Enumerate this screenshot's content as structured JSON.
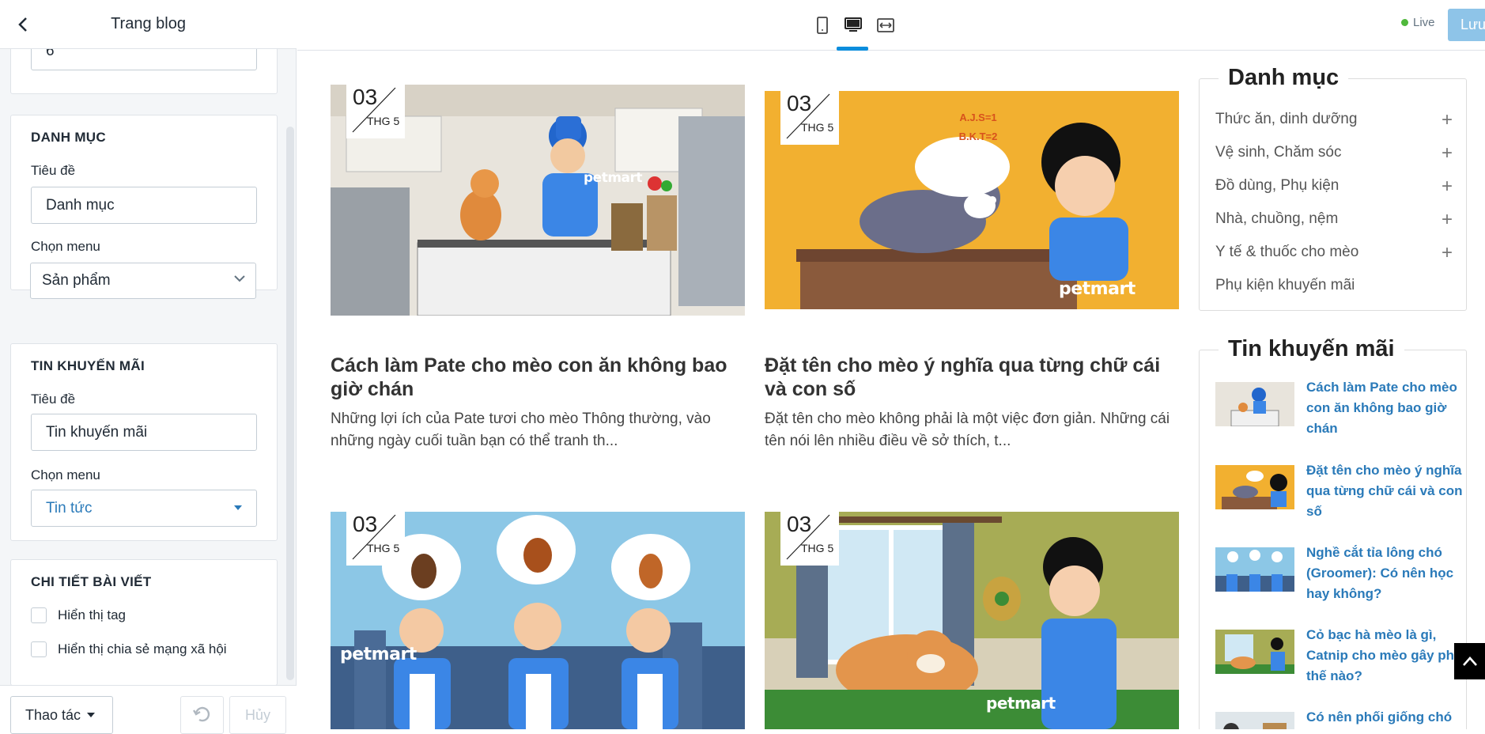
{
  "sidebar": {
    "title": "Trang blog",
    "top_input_value": "6",
    "categories_section": {
      "heading": "DANH MỤC",
      "title_label": "Tiêu đề",
      "title_value": "Danh mục",
      "menu_label": "Chọn menu",
      "menu_value": "Sản phẩm"
    },
    "promo_section": {
      "heading": "TIN KHUYẾN MÃI",
      "title_label": "Tiêu đề",
      "title_value": "Tin khuyến mãi",
      "menu_label": "Chọn menu",
      "menu_value": "Tin tức"
    },
    "detail_section": {
      "heading": "CHI TIẾT BÀI VIẾT",
      "show_tag": "Hiển thị tag",
      "show_share": "Hiển thị chia sẻ mạng xã hội"
    },
    "footer": {
      "actions_label": "Thao tác",
      "cancel_label": "Hủy"
    }
  },
  "toolbar": {
    "live_label": "Live",
    "save_label": "Lưu",
    "viewports": [
      "mobile-icon",
      "desktop-icon",
      "fullwidth-icon"
    ],
    "active_viewport": "desktop-icon",
    "accent": "#0b8ddd"
  },
  "preview": {
    "posts": [
      {
        "day": "03",
        "month": "THG 5",
        "title": "Cách làm Pate cho mèo con ăn không bao giờ chán",
        "excerpt": "Những lợi ích của Pate tươi cho mèo Thông thường, vào những ngày cuối tuần bạn có thể tranh th...",
        "brand": "petmart"
      },
      {
        "day": "03",
        "month": "THG 5",
        "title": "Đặt tên cho mèo ý nghĩa qua từng chữ cái và con số",
        "excerpt": "Đặt tên cho mèo không phải là một việc đơn giản. Những cái tên nói lên nhiều điều về sở thích, t...",
        "brand": "petmart",
        "bubble_line1": "A.J.S=1",
        "bubble_line2": "B.K.T=2"
      },
      {
        "day": "03",
        "month": "THG 5",
        "brand": "petmart"
      },
      {
        "day": "03",
        "month": "THG 5",
        "brand": "petmart"
      }
    ],
    "categories_widget": {
      "title": "Danh mục",
      "items": [
        {
          "label": "Thức ăn, dinh dưỡng",
          "expandable": true
        },
        {
          "label": "Vệ sinh, Chăm sóc",
          "expandable": true
        },
        {
          "label": "Đồ dùng, Phụ kiện",
          "expandable": true
        },
        {
          "label": "Nhà, chuồng, nệm",
          "expandable": true
        },
        {
          "label": "Y tế & thuốc cho mèo",
          "expandable": true
        },
        {
          "label": "Phụ kiện khuyến mãi",
          "expandable": false
        }
      ],
      "plus_symbol": "+"
    },
    "promo_widget": {
      "title": "Tin khuyến mãi",
      "items": [
        "Cách làm Pate cho mèo con ăn không bao giờ chán",
        "Đặt tên cho mèo ý nghĩa qua từng chữ cái và con số",
        "Nghề cắt tỉa lông chó (Groomer): Có nên học hay không?",
        "Cỏ bạc hà mèo là gì, Catnip cho mèo gây phê thế nào?",
        "Có nên phối giống chó"
      ]
    }
  }
}
